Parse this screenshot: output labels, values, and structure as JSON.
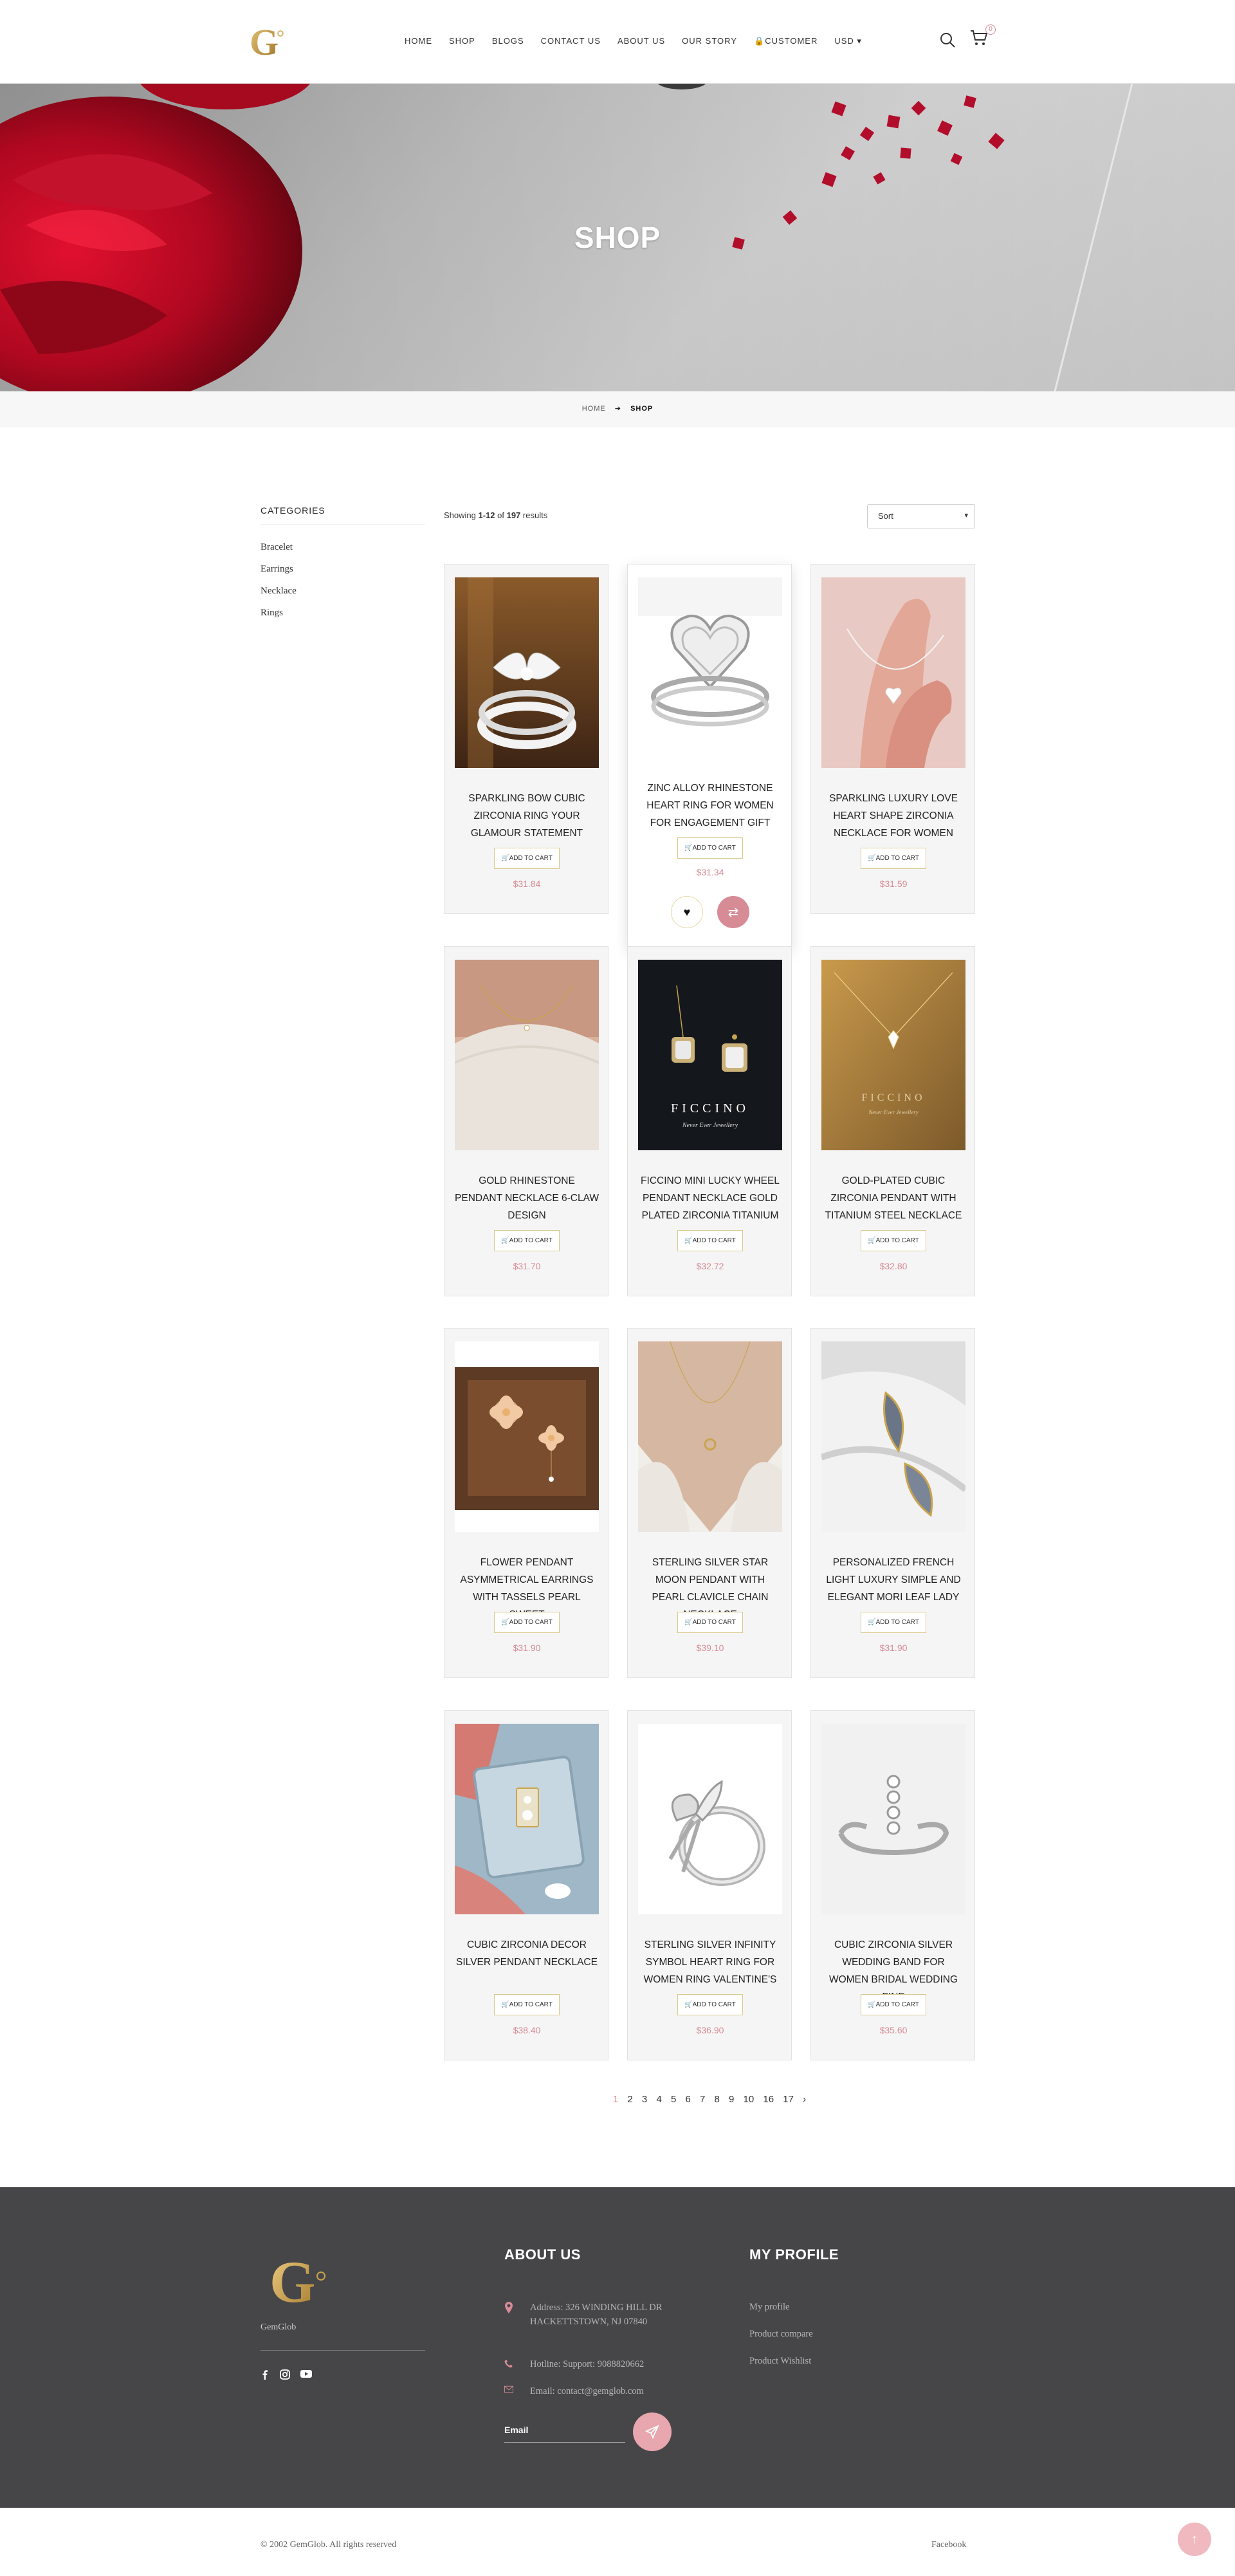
{
  "header": {
    "nav": [
      "HOME",
      "SHOP",
      "BLOGS",
      "CONTACT US",
      "ABOUT US",
      "OUR STORY",
      "CUSTOMER",
      "USD"
    ],
    "cart_count": "0"
  },
  "hero": {
    "title": "SHOP"
  },
  "breadcrumb": {
    "home": "HOME",
    "sep": "➔",
    "current": "SHOP"
  },
  "sidebar": {
    "title": "CATEGORIES",
    "categories": [
      "Bracelet",
      "Earrings",
      "Necklace",
      "Rings"
    ]
  },
  "results": {
    "prefix": "Showing ",
    "range": "1-12",
    "of": " of ",
    "total": "197",
    "suffix": " results"
  },
  "sort": {
    "label": "Sort",
    "caret": "▾"
  },
  "products": [
    {
      "name": "SPARKLING BOW CUBIC ZIRCONIA RING YOUR GLAMOUR STATEMENT",
      "cart": "ADD TO CART",
      "price": "$31.84"
    },
    {
      "name": "ZINC ALLOY RHINESTONE HEART RING FOR WOMEN FOR ENGAGEMENT GIFT",
      "cart": "ADD TO CART",
      "price": "$31.34"
    },
    {
      "name": "SPARKLING LUXURY LOVE HEART SHAPE ZIRCONIA NECKLACE FOR WOMEN",
      "cart": "ADD TO CART",
      "price": "$31.59"
    },
    {
      "name": "GOLD RHINESTONE PENDANT NECKLACE 6-CLAW DESIGN",
      "cart": "ADD TO CART",
      "price": "$31.70"
    },
    {
      "name": "FICCINO MINI LUCKY WHEEL PENDANT NECKLACE GOLD PLATED ZIRCONIA TITANIUM",
      "cart": "ADD TO CART",
      "price": "$32.72"
    },
    {
      "name": "GOLD-PLATED CUBIC ZIRCONIA PENDANT WITH TITANIUM STEEL NECKLACE",
      "cart": "ADD TO CART",
      "price": "$32.80"
    },
    {
      "name": "FLOWER PENDANT ASYMMETRICAL EARRINGS WITH TASSELS PEARL SWEET",
      "cart": "ADD TO CART",
      "price": "$31.90"
    },
    {
      "name": "STERLING SILVER STAR MOON PENDANT WITH PEARL CLAVICLE CHAIN NECKLACE",
      "cart": "ADD TO CART",
      "price": "$39.10"
    },
    {
      "name": "PERSONALIZED FRENCH LIGHT LUXURY SIMPLE AND ELEGANT MORI LEAF LADY",
      "cart": "ADD TO CART",
      "price": "$31.90"
    },
    {
      "name": "CUBIC ZIRCONIA DECOR SILVER PENDANT NECKLACE",
      "cart": "ADD TO CART",
      "price": "$38.40"
    },
    {
      "name": "STERLING SILVER INFINITY SYMBOL HEART RING FOR WOMEN RING VALENTINE'S",
      "cart": "ADD TO CART",
      "price": "$36.90"
    },
    {
      "name": "CUBIC ZIRCONIA SILVER WEDDING BAND FOR WOMEN BRIDAL WEDDING FINE",
      "cart": "ADD TO CART",
      "price": "$35.60"
    }
  ],
  "image_captions": {
    "ficcino_brand": "FICCINO",
    "ficcino_tag": "Never Ever Jewellery"
  },
  "pagination": [
    "1",
    "2",
    "3",
    "4",
    "5",
    "6",
    "7",
    "8",
    "9",
    "10",
    "16",
    "17",
    "›"
  ],
  "footer": {
    "brand": "GemGlob",
    "about_title": "ABOUT US",
    "address": "Address: 326 WINDING HILL DR HACKETTSTOWN, NJ 07840",
    "hotline": "Hotline: Support: 9088820662",
    "email": "Email: contact@gemglob.com",
    "email_placeholder": "Email",
    "profile_title": "MY PROFILE",
    "profile_links": [
      "My profile",
      "Product compare",
      "Product Wishlist"
    ],
    "copyright": "© 2002 GemGlob. All rights reserved",
    "facebook": "Facebook"
  },
  "colors": {
    "accent": "#d68b95",
    "gold": "#c9a44f",
    "footer_bg": "#464648"
  },
  "icons": [
    "search-icon",
    "cart-icon",
    "lock-icon",
    "heart-icon",
    "compare-icon",
    "facebook-icon",
    "instagram-icon",
    "youtube-icon",
    "location-icon",
    "phone-icon",
    "mail-icon",
    "send-icon",
    "arrow-up-icon"
  ]
}
